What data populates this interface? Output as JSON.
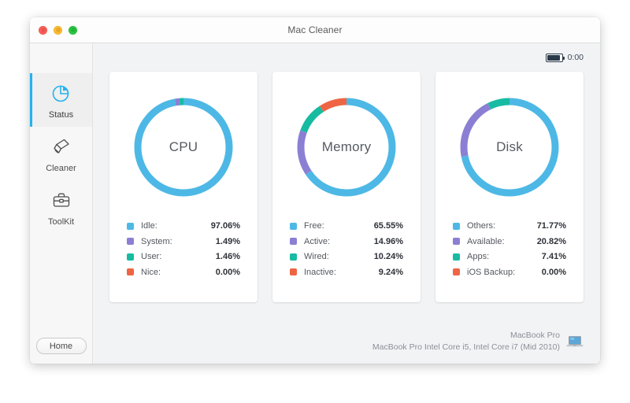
{
  "window": {
    "title": "Mac Cleaner",
    "traffic_lights": [
      "close-button",
      "minimize-button",
      "maximize-button"
    ]
  },
  "sidebar": {
    "items": [
      {
        "label": "Status",
        "icon": "pie-chart-icon",
        "active": true
      },
      {
        "label": "Cleaner",
        "icon": "brush-icon",
        "active": false
      },
      {
        "label": "ToolKit",
        "icon": "toolbox-icon",
        "active": false
      }
    ],
    "home_label": "Home"
  },
  "topbar": {
    "battery_icon": "battery-icon",
    "battery_time": "0:00"
  },
  "colors": {
    "blue": "#4db8e5",
    "purple": "#8b7fd4",
    "teal": "#17bba2",
    "orange": "#ef6544",
    "accent": "#24b2ed",
    "card_bg": "#ffffff",
    "content_bg": "#f2f3f5",
    "sidebar_bg": "#f7f7f7"
  },
  "chart_data": [
    {
      "type": "pie",
      "title": "CPU",
      "legend": "right-below",
      "labels": [
        "Idle:",
        "System:",
        "User:",
        "Nice:"
      ],
      "values": [
        97.06,
        1.49,
        1.46,
        0.0
      ],
      "display_values": [
        "97.06%",
        "1.49%",
        "1.46%",
        "0.00%"
      ],
      "colors": [
        "#4db8e5",
        "#8b7fd4",
        "#17bba2",
        "#ef6544"
      ],
      "donut": true,
      "start_angle": 0
    },
    {
      "type": "pie",
      "title": "Memory",
      "legend": "right-below",
      "labels": [
        "Free:",
        "Active:",
        "Wired:",
        "Inactive:"
      ],
      "values": [
        65.55,
        14.96,
        10.24,
        9.24
      ],
      "display_values": [
        "65.55%",
        "14.96%",
        "10.24%",
        "9.24%"
      ],
      "colors": [
        "#4db8e5",
        "#8b7fd4",
        "#17bba2",
        "#ef6544"
      ],
      "donut": true,
      "start_angle": 0
    },
    {
      "type": "pie",
      "title": "Disk",
      "legend": "right-below",
      "labels": [
        "Others:",
        "Available:",
        "Apps:",
        "iOS Backup:"
      ],
      "values": [
        71.77,
        20.82,
        7.41,
        0.0
      ],
      "display_values": [
        "71.77%",
        "20.82%",
        "7.41%",
        "0.00%"
      ],
      "colors": [
        "#4db8e5",
        "#8b7fd4",
        "#17bba2",
        "#ef6544"
      ],
      "donut": true,
      "start_angle": 0
    }
  ],
  "footer": {
    "model": "MacBook Pro",
    "spec": "MacBook Pro Intel Core i5, Intel Core i7 (Mid 2010)",
    "icon": "macbook-icon"
  }
}
